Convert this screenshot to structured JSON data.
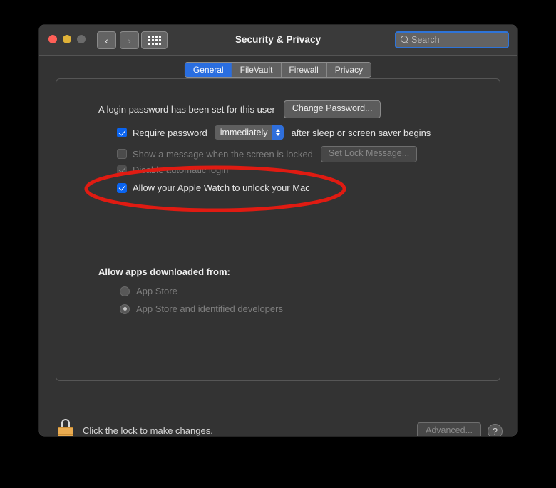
{
  "window": {
    "title": "Security & Privacy",
    "traffic_lights": [
      "close",
      "minimize",
      "zoom"
    ],
    "nav": {
      "back": "‹",
      "forward": "›"
    },
    "grid_button": "show-all-icon",
    "search": {
      "placeholder": "Search",
      "value": "",
      "icon": "search-icon",
      "focused": true
    }
  },
  "tabs": [
    {
      "label": "General",
      "active": true
    },
    {
      "label": "FileVault",
      "active": false
    },
    {
      "label": "Firewall",
      "active": false
    },
    {
      "label": "Privacy",
      "active": false
    }
  ],
  "general": {
    "password_status": "A login password has been set for this user",
    "change_password_button": "Change Password...",
    "require_password": {
      "label": "Require password",
      "checked": true,
      "delay_value": "immediately",
      "suffix": "after sleep or screen saver begins"
    },
    "lock_message": {
      "label": "Show a message when the screen is locked",
      "checked": false,
      "enabled": false,
      "button": "Set Lock Message..."
    },
    "disable_auto_login": {
      "label": "Disable automatic login",
      "checked": true,
      "enabled": false
    },
    "apple_watch": {
      "label": "Allow your Apple Watch to unlock your Mac",
      "checked": true,
      "highlighted": true
    },
    "allow_apps": {
      "heading": "Allow apps downloaded from:",
      "options": [
        {
          "label": "App Store",
          "selected": false
        },
        {
          "label": "App Store and identified developers",
          "selected": true
        }
      ]
    }
  },
  "footer": {
    "lock_icon": "lock-closed-icon",
    "lock_text": "Click the lock to make changes.",
    "advanced_button": "Advanced...",
    "help_button": "?"
  },
  "annotation": {
    "shape": "ellipse",
    "color": "#e01b12",
    "targets": "apple_watch"
  }
}
